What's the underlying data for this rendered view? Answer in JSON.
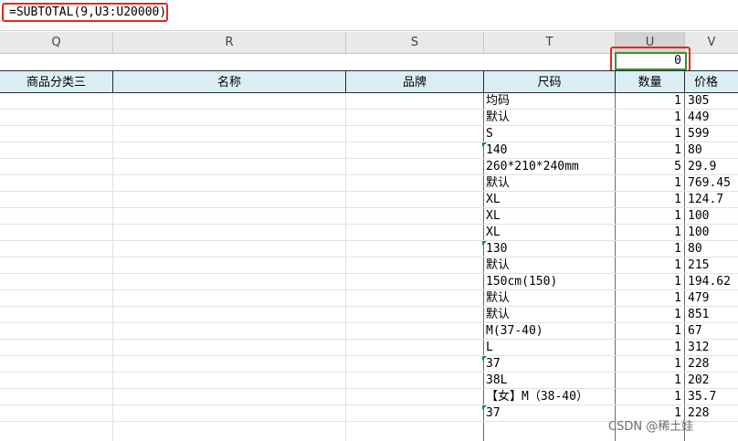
{
  "formula_bar": {
    "formula": "=SUBTOTAL(9,U3:U20000)"
  },
  "column_headers": [
    "Q",
    "R",
    "S",
    "T",
    "U",
    "V"
  ],
  "active_cell_value": "0",
  "table_headers": [
    "商品分类三",
    "名称",
    "品牌",
    "尺码",
    "数量",
    "价格"
  ],
  "rows": [
    {
      "size": "均码",
      "qty": "1",
      "price": "305",
      "flag": false
    },
    {
      "size": "默认",
      "qty": "1",
      "price": "449",
      "flag": false
    },
    {
      "size": "S",
      "qty": "1",
      "price": "599",
      "flag": false
    },
    {
      "size": "140",
      "qty": "1",
      "price": "80",
      "flag": true
    },
    {
      "size": "260*210*240mm",
      "qty": "5",
      "price": "29.9",
      "flag": false
    },
    {
      "size": "默认",
      "qty": "1",
      "price": "769.45",
      "flag": false
    },
    {
      "size": "XL",
      "qty": "1",
      "price": "124.7",
      "flag": false
    },
    {
      "size": "XL",
      "qty": "1",
      "price": "100",
      "flag": false
    },
    {
      "size": "XL",
      "qty": "1",
      "price": "100",
      "flag": false
    },
    {
      "size": "130",
      "qty": "1",
      "price": "80",
      "flag": true
    },
    {
      "size": "默认",
      "qty": "1",
      "price": "215",
      "flag": false
    },
    {
      "size": "150cm(150)",
      "qty": "1",
      "price": "194.62",
      "flag": false
    },
    {
      "size": "默认",
      "qty": "1",
      "price": "479",
      "flag": false
    },
    {
      "size": "默认",
      "qty": "1",
      "price": "851",
      "flag": false
    },
    {
      "size": "M(37-40)",
      "qty": "1",
      "price": "67",
      "flag": false
    },
    {
      "size": "L",
      "qty": "1",
      "price": "312",
      "flag": false
    },
    {
      "size": "37",
      "qty": "1",
      "price": "228",
      "flag": true
    },
    {
      "size": "38L",
      "qty": "1",
      "price": "202",
      "flag": false
    },
    {
      "size": "【女】M（38-40）",
      "qty": "1",
      "price": "35.7",
      "flag": false
    },
    {
      "size": "37",
      "qty": "1",
      "price": "228",
      "flag": true
    }
  ],
  "watermark": "CSDN @稀土娃"
}
